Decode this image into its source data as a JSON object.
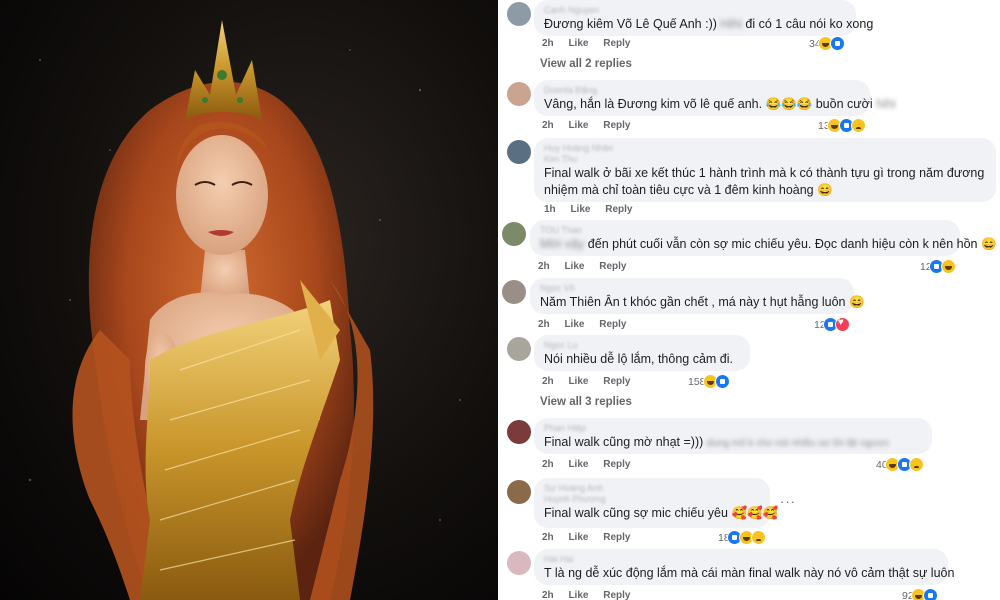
{
  "comments": [
    {
      "name": "Canh Nguyen",
      "text": "Đương kiêm Võ Lê Quế Anh :))",
      "blurred": "Hihi",
      "text2": "đi có 1 câu nói ko xong",
      "time": "2h",
      "like": "Like",
      "reply": "Reply",
      "count": "34",
      "reactions": [
        "haha",
        "like"
      ]
    },
    {
      "name": "Duonta Đặng",
      "text": "Vâng, hắn là Đương kim võ lê quế anh. 😂😂😂 buồn cười",
      "blurred": "hihi",
      "time": "2h",
      "like": "Like",
      "reply": "Reply",
      "count": "13",
      "reactions": [
        "haha",
        "like",
        "sad"
      ]
    },
    {
      "name": "Huy Hoàng Nhân",
      "name2": "Kim Thu",
      "text": "Final walk ở bãi xe kết thúc 1 hành trình mà k có thành tựu gì trong năm đương nhiệm mà chỉ toàn tiêu cực và 1 đêm kinh hoàng 😄",
      "time": "1h",
      "like": "Like",
      "reply": "Reply"
    },
    {
      "name": "TOU Thao",
      "blurred": "Mời vậy",
      "text": "đến phút cuối vẫn còn sợ mic chiếu yêu. Đọc danh hiệu còn k nên hồn 😄",
      "time": "2h",
      "like": "Like",
      "reply": "Reply",
      "count": "12",
      "reactions": [
        "like",
        "haha"
      ]
    },
    {
      "name": "Ngọc Vô",
      "text": "Năm Thiên Ân t khóc gần chết , má này t hụt hẫng luôn 😄",
      "time": "2h",
      "like": "Like",
      "reply": "Reply",
      "count": "12",
      "reactions": [
        "like",
        "love"
      ]
    },
    {
      "name": "Ngọc Lu",
      "text": "Nói nhiều dễ lộ lắm, thông cảm đi.",
      "time": "2h",
      "like": "Like",
      "reply": "Reply",
      "count": "158",
      "reactions": [
        "haha",
        "like"
      ]
    },
    {
      "name": "Phan Hiệp",
      "text": "Final walk cũng mờ nhạt =)))",
      "blurred": "dung mố k cho nói nhiều sợ lời lật ngược",
      "time": "2h",
      "like": "Like",
      "reply": "Reply",
      "count": "40",
      "reactions": [
        "haha",
        "like",
        "sad"
      ]
    },
    {
      "name": "Sự Hoàng Anh",
      "name2": "Huynh Phương",
      "text": "Final walk cũng sợ mic chiếu yêu 🥰🥰🥰",
      "time": "2h",
      "like": "Like",
      "reply": "Reply",
      "count": "18",
      "reactions": [
        "like",
        "haha",
        "sad"
      ],
      "more": "···"
    },
    {
      "name": "Hai Hai",
      "text": "T là ng dễ xúc động lắm mà cái màn final walk này nó vô cảm thật sự luôn",
      "time": "2h",
      "like": "Like",
      "reply": "Reply",
      "count": "92",
      "reactions": [
        "haha",
        "like"
      ]
    }
  ],
  "view_all": [
    "View all 2 replies",
    "View all 3 replies"
  ]
}
